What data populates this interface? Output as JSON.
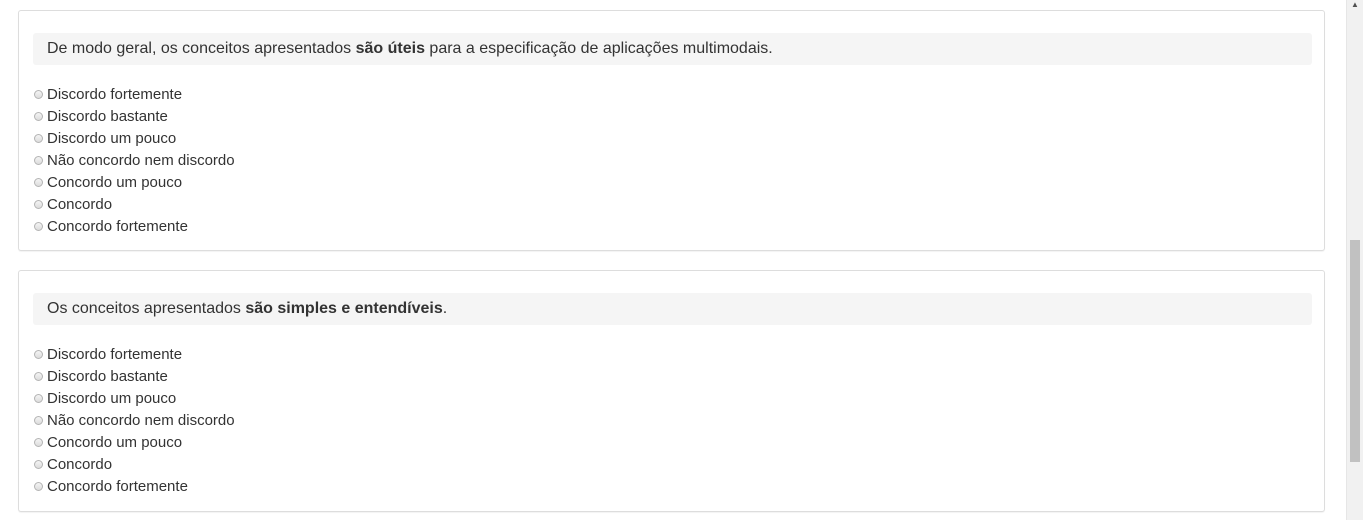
{
  "questions": [
    {
      "text_before": "De modo geral, os conceitos apresentados ",
      "text_bold": "são úteis",
      "text_after": " para a especificação de aplicações multimodais.",
      "options": [
        "Discordo fortemente",
        "Discordo bastante",
        "Discordo um pouco",
        "Não concordo nem discordo",
        "Concordo um pouco",
        "Concordo",
        "Concordo fortemente"
      ]
    },
    {
      "text_before": "Os conceitos apresentados ",
      "text_bold": "são simples e entendíveis",
      "text_after": ".",
      "options": [
        "Discordo fortemente",
        "Discordo bastante",
        "Discordo um pouco",
        "Não concordo nem discordo",
        "Concordo um pouco",
        "Concordo",
        "Concordo fortemente"
      ]
    }
  ],
  "scrollbar": {
    "up_icon": "▲"
  }
}
